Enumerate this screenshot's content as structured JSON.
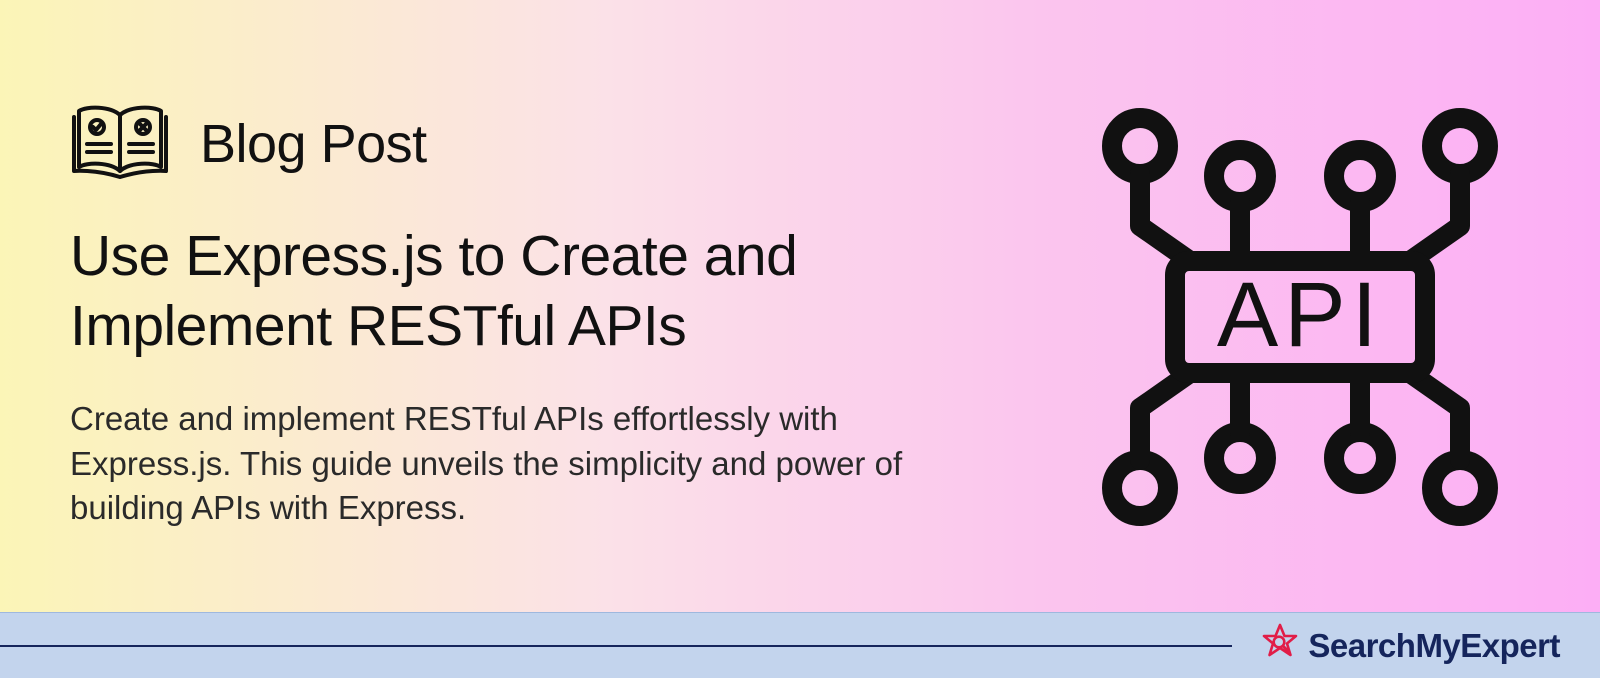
{
  "post": {
    "category": "Blog Post",
    "title": "Use Express.js to Create and Implement RESTful APIs",
    "description": "Create and implement RESTful APIs effortlessly with Express.js. This guide unveils the simplicity and power of building APIs with Express."
  },
  "illustration": {
    "label": "API"
  },
  "brand": {
    "name": "SearchMyExpert"
  },
  "colors": {
    "gradient_start": "#fbf5b7",
    "gradient_end": "#fcaef5",
    "footer_bg": "#c3d4ed",
    "footer_line": "#15255c",
    "text_dark": "#111111",
    "brand_star": "#e11d48"
  }
}
